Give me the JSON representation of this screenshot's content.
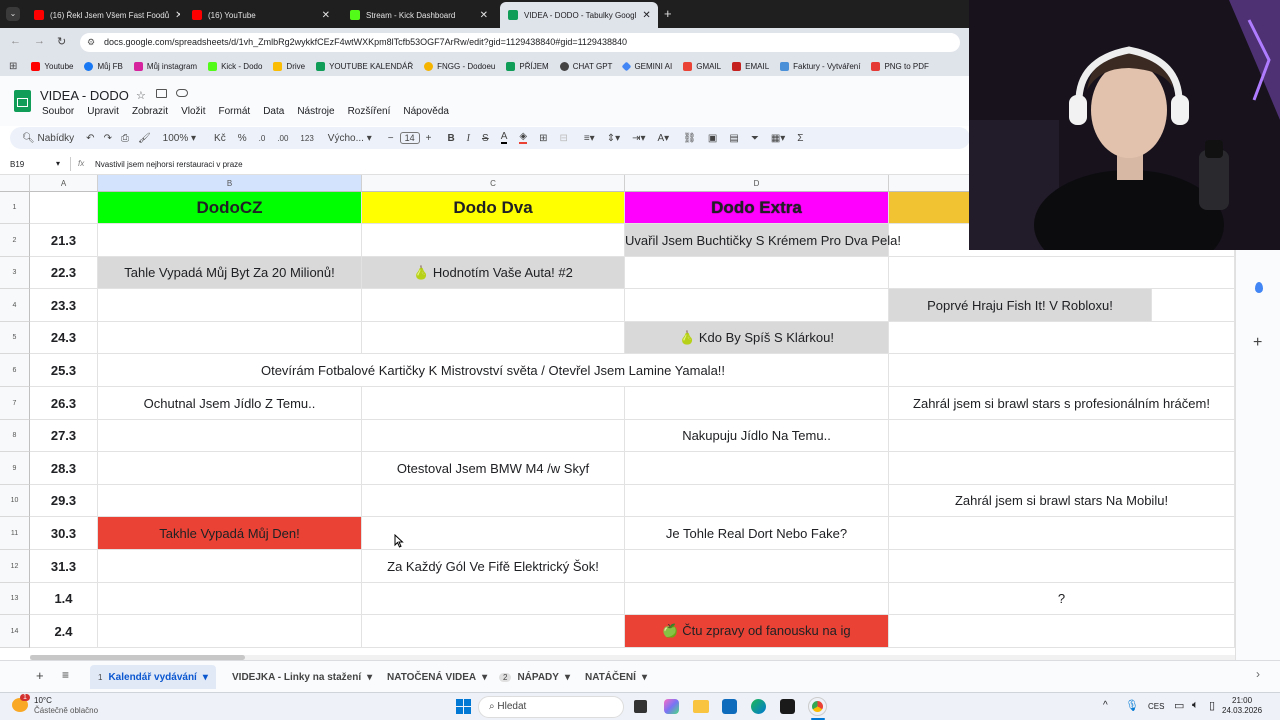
{
  "browser": {
    "tabs": [
      {
        "label": "(16) Řekl Jsem Všem Fast Foodů",
        "icon": "youtube-icon",
        "color": "#ff0000"
      },
      {
        "label": "(16) YouTube",
        "icon": "youtube-icon",
        "color": "#ff0000"
      },
      {
        "label": "Stream - Kick Dashboard",
        "icon": "kick-icon",
        "color": "#53fc18"
      },
      {
        "label": "VIDEA - DODO - Tabulky Googl",
        "icon": "sheets-icon",
        "color": "#0f9d58"
      }
    ],
    "url": "docs.google.com/spreadsheets/d/1vh_ZmlbRg2wykkfCEzF4wtWXKpm8lTcfb53OGF7ArRw/edit?gid=1129438840#gid=1129438840",
    "bookmarks": [
      "Youtube",
      "Můj FB",
      "Můj instagram",
      "Kick - Dodo",
      "Drive",
      "YOUTUBE KALENDÁŘ",
      "FNGG - Dodoeu",
      "PŘÍJEM",
      "CHAT GPT",
      "GEMINI AI",
      "GMAIL",
      "EMAIL",
      "Faktury - Vytváření",
      "PNG to PDF"
    ]
  },
  "doc": {
    "title": "VIDEA - DODO",
    "menu": [
      "Soubor",
      "Upravit",
      "Zobrazit",
      "Vložit",
      "Formát",
      "Data",
      "Nástroje",
      "Rozšíření",
      "Nápověda"
    ]
  },
  "toolbar": {
    "search": "Nabídky",
    "zoom": "100%",
    "currency": "Kč",
    "percent": "%",
    "dec_less": ".0",
    "dec_more": ".00",
    "numfmt": "123",
    "font": "Výcho...",
    "font_size": "14",
    "bold": "B",
    "italic": "I",
    "sum": "Σ"
  },
  "formula_bar": {
    "cell_ref": "B19",
    "value": "Nvastivil jsem nejhorsi rerstauraci v praze"
  },
  "columns": [
    "A",
    "B",
    "C",
    "D"
  ],
  "header_row": {
    "num": "1",
    "b": "DodoCZ",
    "c": "Dodo Dva",
    "d": "Dodo Extra"
  },
  "rows": [
    {
      "num": "2",
      "date": "21.3",
      "b": "",
      "c": "",
      "d": "Uvařil Jsem Buchtičky S Krémem Pro Dva Pela!",
      "e": ""
    },
    {
      "num": "3",
      "date": "22.3",
      "b": "Tahle Vypadá Můj Byt Za 20 Milionů!",
      "c": "🍐 Hodnotím Vaše Auta! #2",
      "d": "",
      "e": ""
    },
    {
      "num": "4",
      "date": "23.3",
      "b": "",
      "c": "",
      "d": "",
      "e": "Poprvé Hraju Fish It! V Robloxu!"
    },
    {
      "num": "5",
      "date": "24.3",
      "b": "",
      "c": "",
      "d": "🍐 Kdo By Spíš S Klárkou!",
      "e": ""
    },
    {
      "num": "6",
      "date": "25.3",
      "merged": "Otevírám Fotbalové Kartičky K Mistrovství světa / Otevřel Jsem Lamine Yamala!!"
    },
    {
      "num": "7",
      "date": "26.3",
      "b": "Ochutnal Jsem Jídlo Z Temu..",
      "c": "",
      "d": "",
      "e": "Zahrál jsem si brawl stars s profesionálním hráčem!"
    },
    {
      "num": "8",
      "date": "27.3",
      "b": "",
      "c": "",
      "d": "Nakupuju Jídlo Na Temu..",
      "e": ""
    },
    {
      "num": "9",
      "date": "28.3",
      "b": "",
      "c": "Otestoval Jsem BMW M4 /w Skyf",
      "d": "",
      "e": ""
    },
    {
      "num": "10",
      "date": "29.3",
      "b": "",
      "c": "",
      "d": "",
      "e": "Zahrál jsem si brawl stars Na Mobilu!"
    },
    {
      "num": "11",
      "date": "30.3",
      "b": "Takhle Vypadá Můj Den!",
      "c": "",
      "d": "Je Tohle Real Dort Nebo Fake?",
      "e": ""
    },
    {
      "num": "12",
      "date": "31.3",
      "b": "",
      "c": "Za Každý Gól Ve Fifě Elektrický Šok!",
      "d": "",
      "e": ""
    },
    {
      "num": "13",
      "date": "1.4",
      "b": "",
      "c": "",
      "d": "",
      "e": "?"
    },
    {
      "num": "14",
      "date": "2.4",
      "b": "",
      "c": "",
      "d": "🍏 Čtu zpravy od fanousku na ig",
      "e": ""
    }
  ],
  "sheet_tabs": [
    {
      "badge": "1",
      "label": "Kalendář vydávání",
      "active": true
    },
    {
      "badge": "",
      "label": "VIDEJKA - Linky na stažení",
      "active": false
    },
    {
      "badge": "",
      "label": "NATOČENÁ VIDEA",
      "active": false
    },
    {
      "badge": "2",
      "label": "NÁPADY",
      "active": false
    },
    {
      "badge": "",
      "label": "NATÁČENÍ",
      "active": false
    }
  ],
  "taskbar": {
    "weather_temp": "10°C",
    "weather_desc": "Částečně oblačno",
    "notif_count": "1",
    "search": "Hledat",
    "lang": "CES",
    "time": "21:00",
    "date": "24.03.2026"
  },
  "colors": {
    "dodocz": "#00ff00",
    "dodo_dva": "#ffff00",
    "dodo_extra": "#ff00ff",
    "extra_e": "#f1c232",
    "gray": "#d9d9d9",
    "red": "#ea4335"
  }
}
